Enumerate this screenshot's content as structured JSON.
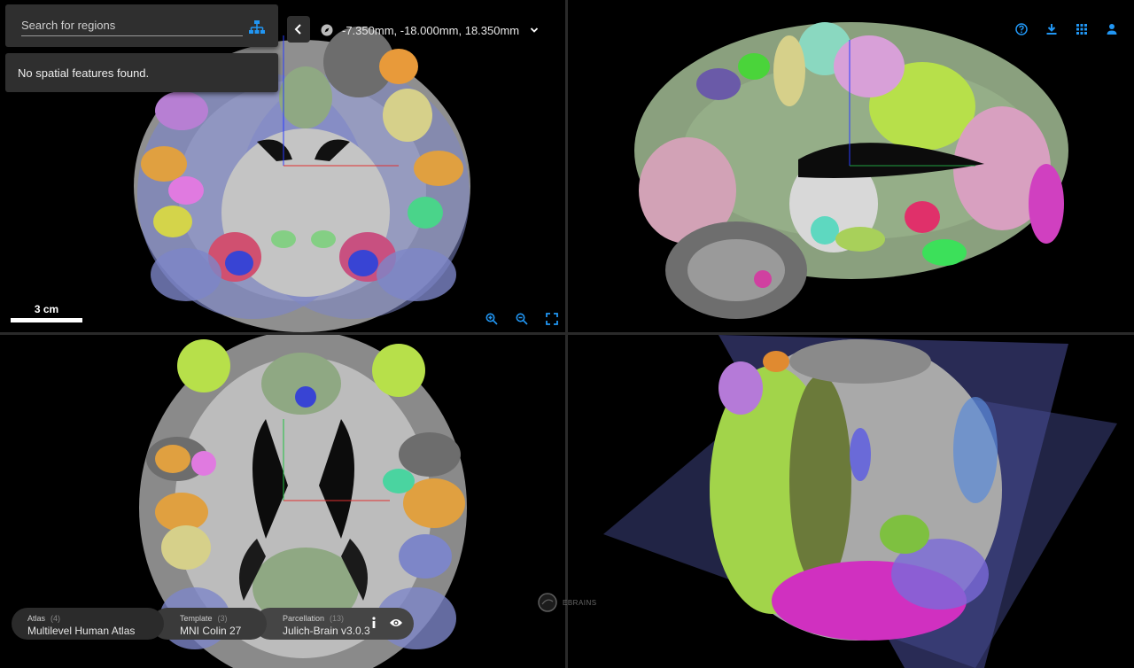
{
  "search": {
    "placeholder": "Search for regions"
  },
  "features": {
    "message": "No spatial features found."
  },
  "coordinates": {
    "text": "-7.350mm, -18.000mm, 18.350mm"
  },
  "scale": {
    "label": "3 cm"
  },
  "branding": {
    "text": "EBRAINS"
  },
  "chips": {
    "atlas": {
      "title": "Atlas",
      "count": "(4)",
      "value": "Multilevel Human Atlas"
    },
    "template": {
      "title": "Template",
      "count": "(3)",
      "value": "MNI Colin 27"
    },
    "parcellation": {
      "title": "Parcellation",
      "count": "(13)",
      "value": "Julich-Brain v3.0.3"
    }
  },
  "icons": {
    "top_right": [
      "help-icon",
      "download-icon",
      "apps-grid-icon",
      "account-icon"
    ],
    "viewport_tools": [
      "zoom-in-icon",
      "zoom-out-icon",
      "maximize-icon"
    ]
  },
  "colors": {
    "accent": "#2196f3",
    "panel": "#2f2f2f"
  }
}
